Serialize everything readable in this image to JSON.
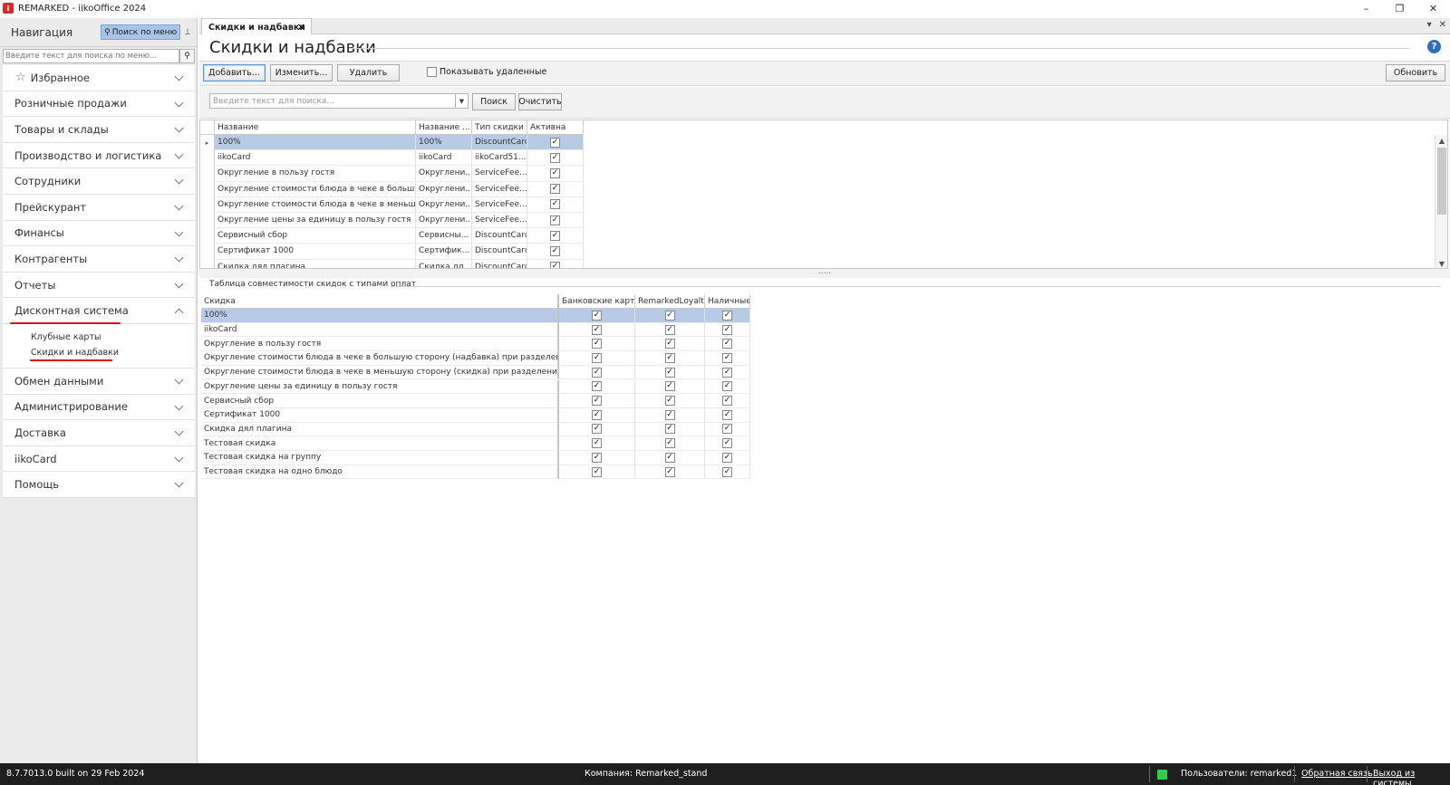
{
  "window": {
    "title": "REMARKED - iikoOffice 2024",
    "controls": {
      "minimize": "–",
      "restore": "❐",
      "close": "✕"
    }
  },
  "nav": {
    "title": "Навигация",
    "menu_search_label": "Поиск по меню",
    "search_placeholder": "Введите текст для поиска по меню...",
    "items": [
      {
        "label": "Избранное",
        "icon": "star-icon",
        "expanded": false
      },
      {
        "label": "Розничные продажи",
        "expanded": false
      },
      {
        "label": "Товары и склады",
        "expanded": false
      },
      {
        "label": "Производство и логистика",
        "expanded": false
      },
      {
        "label": "Сотрудники",
        "expanded": false
      },
      {
        "label": "Прейскурант",
        "expanded": false
      },
      {
        "label": "Финансы",
        "expanded": false
      },
      {
        "label": "Контрагенты",
        "expanded": false
      },
      {
        "label": "Отчеты",
        "expanded": false
      },
      {
        "label": "Дисконтная система",
        "expanded": true
      },
      {
        "label": "Обмен данными",
        "expanded": false
      },
      {
        "label": "Администрирование",
        "expanded": false
      },
      {
        "label": "Доставка",
        "expanded": false
      },
      {
        "label": "iikoCard",
        "expanded": false
      },
      {
        "label": "Помощь",
        "expanded": false
      }
    ],
    "subitems": [
      "Клубные карты",
      "Скидки и надбавки"
    ]
  },
  "tabs": [
    {
      "label": "Скидки и надбавки",
      "active": true
    }
  ],
  "page": {
    "title": "Скидки и надбавки",
    "toolbar": {
      "add": "Добавить...",
      "edit": "Изменить...",
      "delete": "Удалить",
      "show_deleted": "Показывать удаленные",
      "show_deleted_checked": false,
      "refresh": "Обновить"
    },
    "search": {
      "placeholder": "Введите текст для поиска...",
      "search_button": "Поиск",
      "clear_button": "Очистить"
    },
    "grid1": {
      "columns": [
        "Название",
        "Название ...",
        "Тип скидки",
        "Активна"
      ],
      "rows": [
        [
          "100%",
          "100%",
          "DiscountCard",
          true
        ],
        [
          "iikoCard",
          "iikoCard",
          "iikoCard51...",
          true
        ],
        [
          "Округление в пользу гостя",
          "Округлени...",
          "ServiceFee...",
          true
        ],
        [
          "Округление стоимости блюда в чеке в большую сторону (...",
          "Округлени...",
          "ServiceFee...",
          true
        ],
        [
          "Округление стоимости блюда в чеке в меньшую сторону (...",
          "Округлени...",
          "ServiceFee...",
          true
        ],
        [
          "Округление цены за единицу в пользу гостя",
          "Округлени...",
          "ServiceFee...",
          true
        ],
        [
          "Сервисный сбор",
          "Сервисны...",
          "DiscountCard",
          true
        ],
        [
          "Сертификат 1000",
          "Сертифик...",
          "DiscountCard",
          true
        ],
        [
          "Скидка дял плагина",
          "Скидка дл...",
          "DiscountCard",
          true
        ]
      ]
    },
    "splitter_label": ".....",
    "group_label": "Таблица совместимости скидок с типами оплат",
    "grid2": {
      "columns": [
        "Скидка",
        "Банковские карты",
        "RemarkedLoyalty",
        "Наличные"
      ],
      "rows": [
        "100%",
        "iikoCard",
        "Округление в пользу гостя",
        "Округление стоимости блюда в чеке в большую сторону (надбавка) при разделении блюда",
        "Округление стоимости блюда в чеке в меньшую сторону (скидка) при разделении блюда",
        "Округление цены за единицу в пользу гостя",
        "Сервисный сбор",
        "Сертификат 1000",
        "Скидка дял плагина",
        "Тестовая скидка",
        "Тестовая скидка на группу",
        "Тестовая скидка на одно блюдо"
      ]
    }
  },
  "status": {
    "build": "8.7.7013.0 built on 29 Feb 2024",
    "company": "Компания: Remarked_stand",
    "users": "Пользователи: remarked1",
    "feedback": "Обратная связь",
    "logout": "Выход из системы"
  },
  "colors": {
    "selection": "#b8cbe6",
    "menu_search_bg": "#a9c4e6",
    "status_led": "#2fcf4a",
    "annotation_red": "#dd1111",
    "help_icon": "#2d6fc4"
  }
}
